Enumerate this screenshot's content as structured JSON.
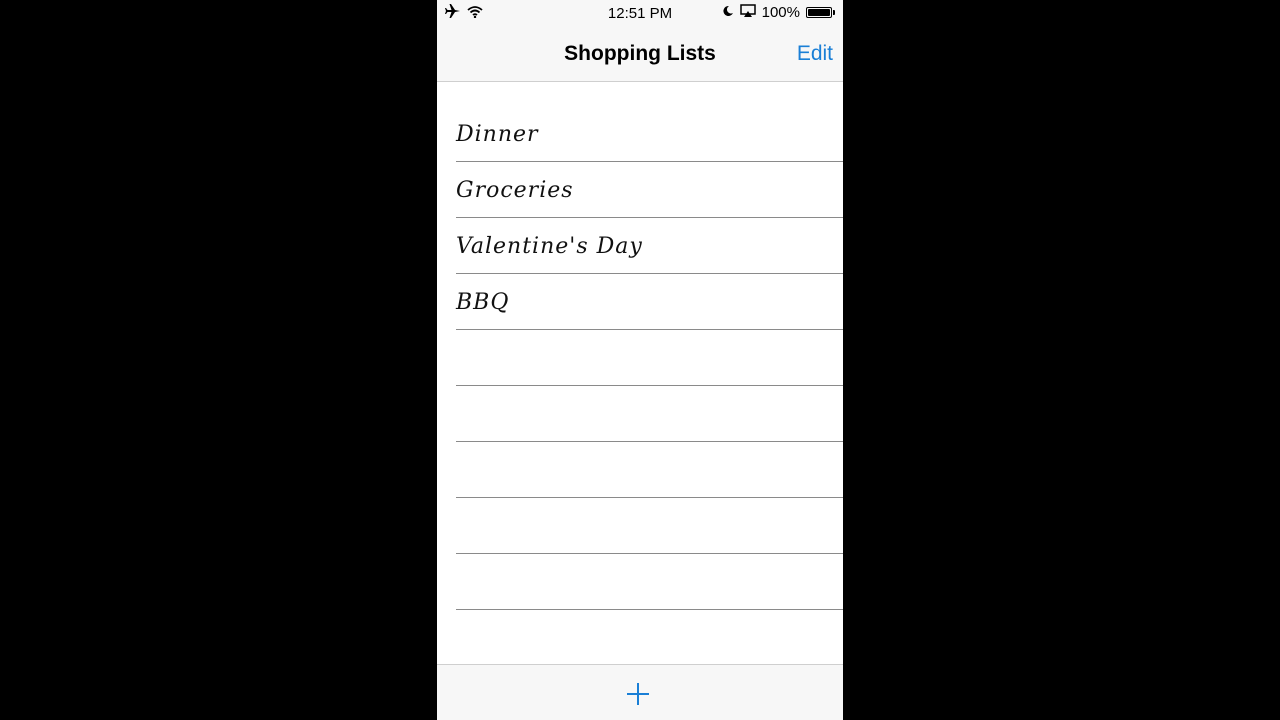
{
  "status_bar": {
    "time": "12:51 PM",
    "battery_text": "100%",
    "battery_level": 1.0,
    "icons": [
      "airplane-icon",
      "wifi-icon",
      "moon-icon",
      "airplay-icon",
      "battery-icon"
    ]
  },
  "nav": {
    "title": "Shopping Lists",
    "edit_label": "Edit"
  },
  "lists": [
    {
      "label": "Dinner"
    },
    {
      "label": "Groceries"
    },
    {
      "label": "Valentine's Day"
    },
    {
      "label": "BBQ"
    },
    {
      "label": ""
    },
    {
      "label": ""
    },
    {
      "label": ""
    },
    {
      "label": ""
    },
    {
      "label": ""
    },
    {
      "label": ""
    }
  ],
  "toolbar": {
    "add_icon": "plus-icon"
  },
  "colors": {
    "accent": "#1a7fd6",
    "bar_background": "#f7f7f7",
    "rule_line": "#8a8a8a"
  }
}
